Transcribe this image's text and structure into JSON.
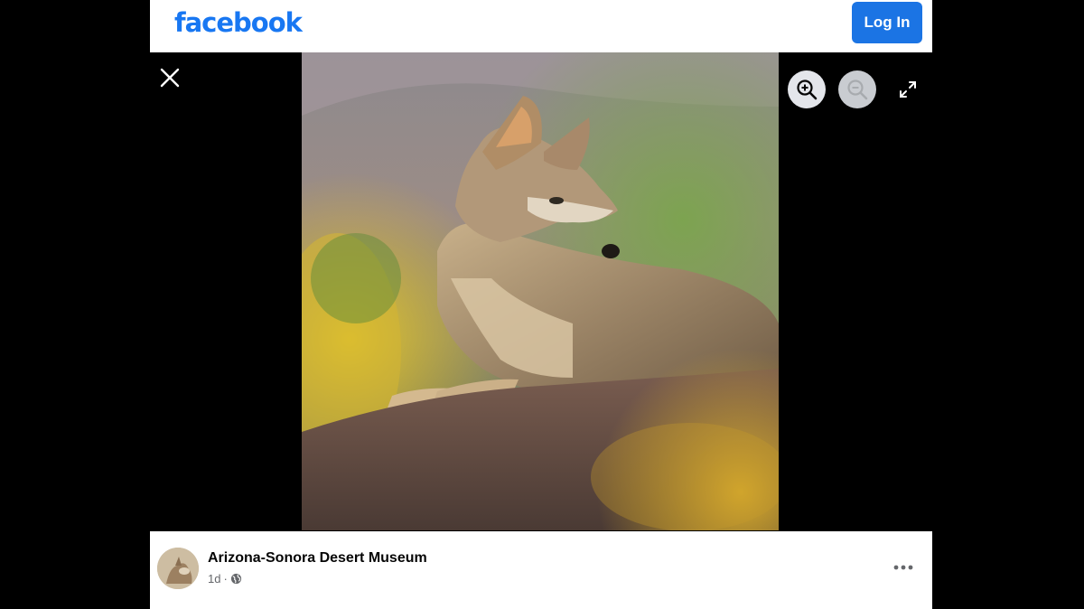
{
  "header": {
    "logo_text": "facebook",
    "login_label": "Log In",
    "brand_color": "#1877f2"
  },
  "viewer": {
    "icons": {
      "close": "close-icon",
      "zoom_in": "zoom-in-icon",
      "zoom_out": "zoom-out-icon",
      "fullscreen": "expand-icon"
    },
    "photo_subject": "coyote resting on a rock"
  },
  "post": {
    "page_name": "Arizona-Sonora Desert Museum",
    "time": "1d",
    "separator": "·",
    "audience_icon": "globe-icon",
    "more_icon": "more-options-icon"
  }
}
